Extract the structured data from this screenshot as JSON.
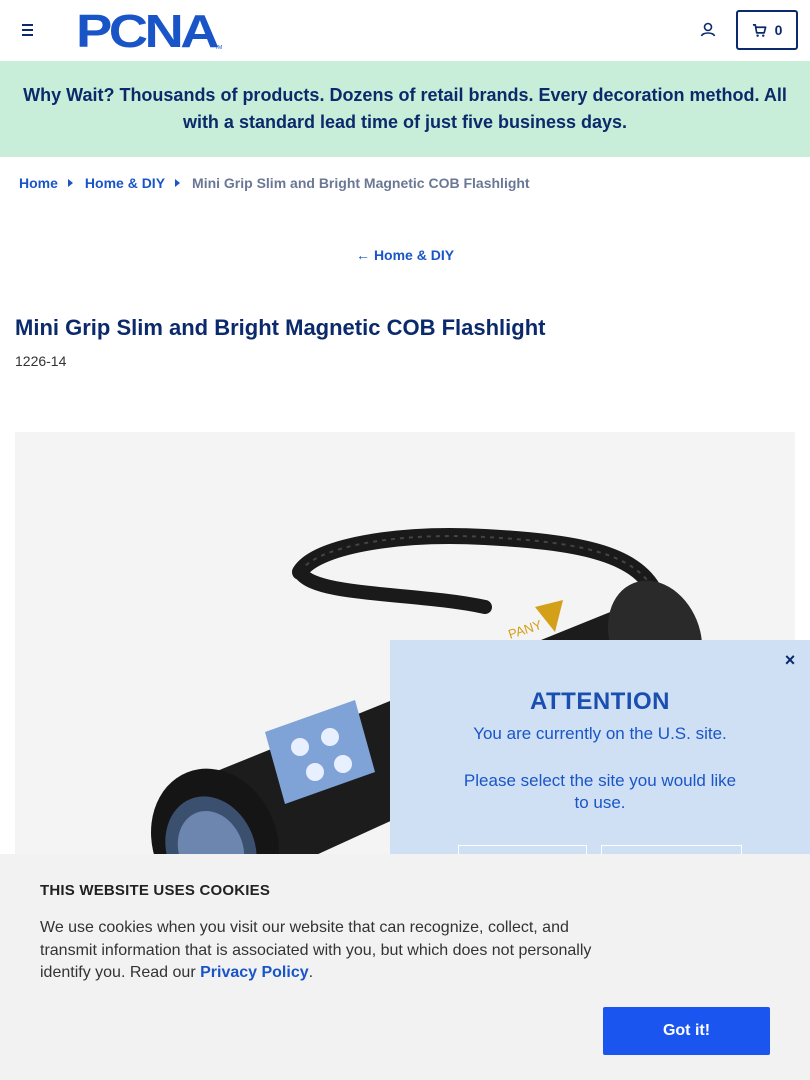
{
  "header": {
    "logo_text": "PCNA",
    "logo_tm": "TM",
    "cart_count": "0"
  },
  "promo": {
    "text": "Why Wait? Thousands of products. Dozens of retail brands. Every decoration method. All with a standard lead time of just five business days."
  },
  "breadcrumb": {
    "items": [
      "Home",
      "Home & DIY"
    ],
    "current": "Mini Grip Slim and Bright Magnetic COB Flashlight"
  },
  "back_link": {
    "arrow": "←",
    "label": "Home & DIY"
  },
  "product": {
    "title": "Mini Grip Slim and Bright Magnetic COB Flashlight",
    "sku": "1226-14",
    "imprint_text": "PANY"
  },
  "attention": {
    "close": "×",
    "heading": "ATTENTION",
    "line1": "You are currently on the U.S. site.",
    "line2": "Please select the site you would like to use."
  },
  "cookie": {
    "heading": "THIS WEBSITE USES COOKIES",
    "text": "We use cookies when you visit our website that can recognize, collect, and transmit information that is associated with you, but which does not personally identify you. Read our ",
    "link": "Privacy Policy",
    "end": ".",
    "button": "Got it!"
  },
  "colors": {
    "navy": "#0b2a6b",
    "link_blue": "#1a55c8",
    "promo_bg": "#c8eed9",
    "popup_bg": "#cfe0f5",
    "cookie_button": "#1a55f0"
  }
}
